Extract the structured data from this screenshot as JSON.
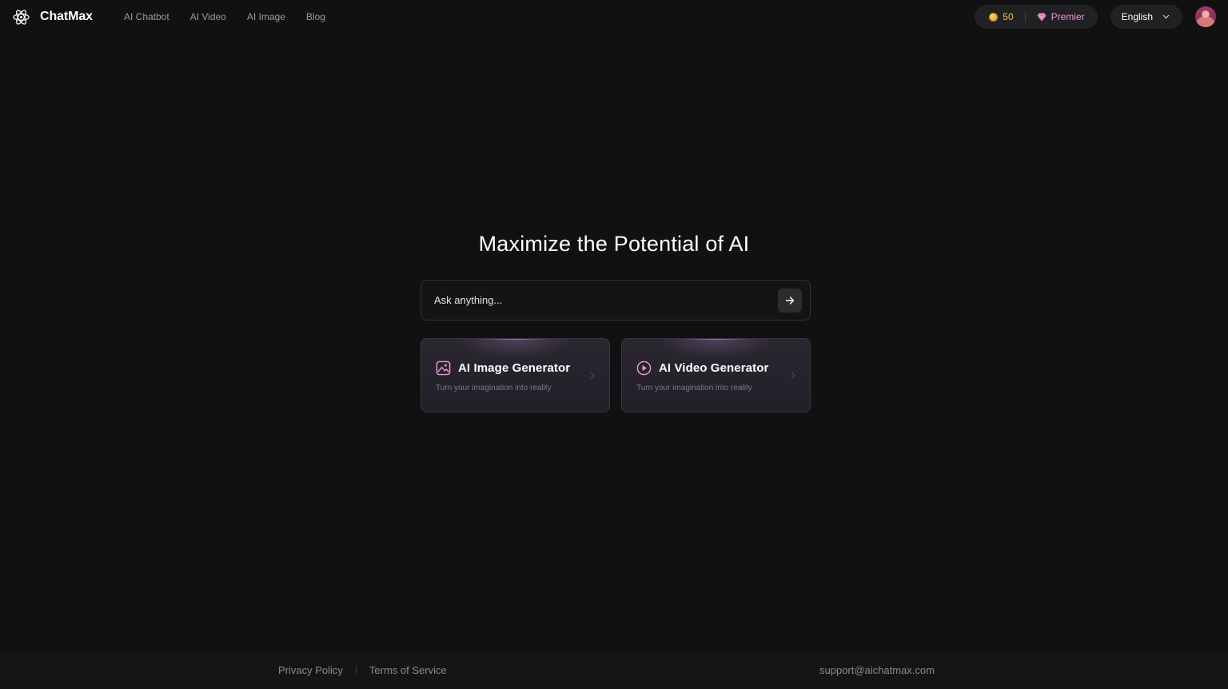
{
  "app": {
    "name": "ChatMax"
  },
  "nav": {
    "items": [
      {
        "label": "AI Chatbot"
      },
      {
        "label": "AI Video"
      },
      {
        "label": "AI Image"
      },
      {
        "label": "Blog"
      }
    ]
  },
  "header": {
    "credits": "50",
    "plan_label": "Premier",
    "language": "English"
  },
  "hero": {
    "title": "Maximize the Potential of AI",
    "ask_placeholder": "Ask anything..."
  },
  "cards": [
    {
      "title": "AI Image Generator",
      "subtitle": "Turn your imagination into reality",
      "icon": "image-icon"
    },
    {
      "title": "AI Video Generator",
      "subtitle": "Turn your imagination into reality",
      "icon": "play-circle-icon"
    }
  ],
  "footer": {
    "privacy": "Privacy Policy",
    "terms": "Terms of Service",
    "email": "support@aichatmax.com"
  },
  "colors": {
    "background": "#121112",
    "accent_pink": "#f09ad6",
    "coin": "#f2b84b",
    "card_bg": "#2b2731"
  }
}
